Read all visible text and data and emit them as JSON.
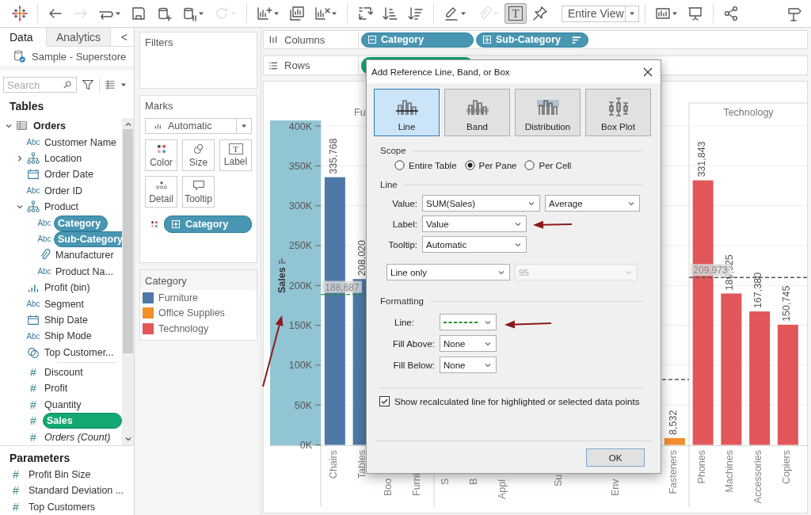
{
  "toolbar": {
    "groups": [
      [
        {
          "kind": "logo",
          "on": false,
          "disabled": false
        }
      ],
      [
        {
          "kind": "undo",
          "on": false,
          "disabled": false
        },
        {
          "kind": "redo",
          "on": false,
          "disabled": true
        },
        {
          "kind": "replay",
          "on": false,
          "disabled": false
        },
        {
          "kind": "save",
          "on": false,
          "disabled": false
        },
        {
          "kind": "new-source",
          "on": false,
          "disabled": false
        },
        {
          "kind": "pause",
          "on": false,
          "disabled": false
        },
        {
          "kind": "refresh",
          "on": false,
          "disabled": true
        }
      ],
      [
        {
          "kind": "new-sheet",
          "on": false,
          "disabled": false
        },
        {
          "kind": "duplicate",
          "on": false,
          "disabled": false
        },
        {
          "kind": "clear",
          "on": false,
          "disabled": false
        }
      ],
      [
        {
          "kind": "swap",
          "on": false,
          "disabled": false
        },
        {
          "kind": "sort-asc",
          "on": false,
          "disabled": false
        },
        {
          "kind": "sort-desc",
          "on": false,
          "disabled": false
        }
      ],
      [
        {
          "kind": "highlight",
          "on": false,
          "disabled": false
        },
        {
          "kind": "annotate",
          "on": false,
          "disabled": true
        },
        {
          "kind": "labels",
          "glyph": "T",
          "on": true,
          "disabled": false
        },
        {
          "kind": "pin",
          "on": false,
          "disabled": false
        },
        {
          "kind": "fit",
          "label": "Entire View"
        }
      ],
      [
        {
          "kind": "show-me",
          "on": false,
          "disabled": false
        },
        {
          "kind": "present",
          "on": false,
          "disabled": false
        }
      ],
      [
        {
          "kind": "share",
          "on": false,
          "disabled": false
        }
      ],
      [
        {
          "kind": "signpost",
          "on": false,
          "disabled": false
        }
      ]
    ]
  },
  "data_pane": {
    "tabs": [
      {
        "label": "Data",
        "selected": true
      },
      {
        "label": "Analytics",
        "selected": false
      }
    ],
    "collapse": "<",
    "source": "Sample - Superstore",
    "search": {
      "placeholder": "Search"
    },
    "tables_heading": "Tables",
    "tables": [
      {
        "name": "Orders",
        "kind": "table",
        "expanded": true,
        "selected": false,
        "children": [
          {
            "name": "Customer Name",
            "kind": "string",
            "icon_text": "Abc",
            "selected": false
          },
          {
            "name": "Location",
            "kind": "hierarchy",
            "expanded": false,
            "selected": false
          },
          {
            "name": "Order Date",
            "kind": "date",
            "selected": false
          },
          {
            "name": "Order ID",
            "kind": "string",
            "icon_text": "Abc",
            "selected": false
          },
          {
            "name": "Product",
            "kind": "hierarchy",
            "expanded": true,
            "selected": false,
            "children": [
              {
                "name": "Category",
                "kind": "string",
                "icon_text": "Abc",
                "selected": true
              },
              {
                "name": "Sub-Category",
                "kind": "string",
                "icon_text": "Abc",
                "selected": true
              },
              {
                "name": "Manufacturer",
                "kind": "group",
                "selected": false
              },
              {
                "name": "Product Na...",
                "kind": "string",
                "icon_text": "Abc",
                "selected": false
              }
            ]
          },
          {
            "name": "Profit (bin)",
            "kind": "bin",
            "selected": false
          },
          {
            "name": "Segment",
            "kind": "string",
            "icon_text": "Abc",
            "selected": false
          },
          {
            "name": "Ship Date",
            "kind": "date",
            "selected": false
          },
          {
            "name": "Ship Mode",
            "kind": "string",
            "icon_text": "Abc",
            "selected": false
          },
          {
            "name": "Top Customer...",
            "kind": "set",
            "selected": false
          },
          {
            "name": "Discount",
            "kind": "measure",
            "icon_text": "#",
            "selected": false
          },
          {
            "name": "Profit",
            "kind": "measure",
            "icon_text": "#",
            "selected": false
          },
          {
            "name": "Quantity",
            "kind": "measure",
            "icon_text": "#",
            "selected": false
          },
          {
            "name": "Sales",
            "kind": "measure",
            "icon_text": "#",
            "selected": true
          },
          {
            "name": "Orders (Count)",
            "kind": "count",
            "icon_text": "#",
            "selected": false
          }
        ]
      }
    ],
    "parameters_heading": "Parameters",
    "parameters": [
      {
        "name": "Profit Bin Size",
        "icon_text": "#"
      },
      {
        "name": "Standard Deviation ...",
        "icon_text": "#"
      },
      {
        "name": "Top Customers",
        "icon_text": "#"
      }
    ]
  },
  "filters": {
    "title": "Filters"
  },
  "marks": {
    "title": "Marks",
    "mark_type": "Automatic",
    "buttons": [
      {
        "label": "Color",
        "kind": "color"
      },
      {
        "label": "Size",
        "kind": "size"
      },
      {
        "label": "Label",
        "kind": "label",
        "glyph": "T"
      },
      {
        "label": "Detail",
        "kind": "detail"
      },
      {
        "label": "Tooltip",
        "kind": "tooltip"
      }
    ],
    "pills": [
      {
        "label": "Category",
        "kind": "color"
      }
    ]
  },
  "legend": {
    "title": "Category",
    "items": [
      {
        "label": "Furniture",
        "color": "#4e79a7"
      },
      {
        "label": "Office Supplies",
        "color": "#f28e2b"
      },
      {
        "label": "Technology",
        "color": "#e15759"
      }
    ]
  },
  "columns_shelf": {
    "label": "Columns",
    "pills": [
      {
        "label": "Category",
        "expanded": true,
        "sorted": false
      },
      {
        "label": "Sub-Category",
        "expanded": false,
        "sorted": true
      }
    ]
  },
  "rows_shelf": {
    "label": "Rows",
    "pills": [
      {
        "kind": "measure"
      }
    ]
  },
  "viz": {
    "axis_selected": true,
    "pane_headers": [
      "Fu",
      "Technology"
    ],
    "cut_axis_labels": [
      "Boo",
      "Furni",
      "S",
      "B",
      "Appl",
      "Su",
      "Env"
    ],
    "chart_data": {
      "type": "bar",
      "ylabel": "Sales",
      "grid": true,
      "ylim": [
        0,
        407000
      ],
      "categories": [
        "Chairs",
        "Tables",
        null,
        null,
        null,
        null,
        null,
        null,
        null,
        null,
        null,
        null,
        "Fasteners",
        "Phones",
        "Machines",
        "Accessories",
        "Copiers"
      ],
      "series": [
        {
          "color": "#4e79a7",
          "values": [
            335768,
            208020,
            null,
            null,
            null,
            null,
            null,
            null,
            null,
            null,
            null,
            null,
            null,
            null,
            null,
            null,
            null
          ]
        },
        {
          "color": "#f28e2b",
          "values": [
            null,
            null,
            null,
            null,
            null,
            null,
            null,
            null,
            null,
            null,
            null,
            null,
            8532,
            null,
            null,
            null,
            null
          ]
        },
        {
          "color": "#e15759",
          "values": [
            null,
            null,
            null,
            null,
            null,
            null,
            null,
            null,
            null,
            null,
            null,
            null,
            null,
            331843,
            189925,
            167380,
            150745
          ]
        }
      ],
      "value_labels": [
        "335,768",
        "208,020",
        null,
        null,
        null,
        null,
        null,
        null,
        null,
        null,
        null,
        null,
        "8,532",
        "331,843",
        "189,925",
        "167,380",
        "150,745"
      ],
      "yticks": [
        {
          "value": 0,
          "label": "0K"
        },
        {
          "value": 50000,
          "label": "50K"
        },
        {
          "value": 100000,
          "label": "100K"
        },
        {
          "value": 150000,
          "label": "150K"
        },
        {
          "value": 200000,
          "label": "200K"
        },
        {
          "value": 250000,
          "label": "250K"
        },
        {
          "value": 300000,
          "label": "300K"
        },
        {
          "value": 350000,
          "label": "350K"
        },
        {
          "value": 400000,
          "label": "400K"
        }
      ],
      "ref_lines": [
        {
          "axis": "y",
          "value": 188687,
          "label": "188,687",
          "color": "#2e8b2e"
        },
        {
          "axis": "y",
          "value": 209973,
          "label": "209,973",
          "color": "#555555"
        }
      ]
    }
  },
  "dialog": {
    "title": "Add Reference Line, Band, or Box",
    "types": [
      {
        "label": "Line",
        "kind": "line",
        "selected": true
      },
      {
        "label": "Band",
        "kind": "band",
        "selected": false
      },
      {
        "label": "Distribution",
        "kind": "distribution",
        "selected": false
      },
      {
        "label": "Box Plot",
        "kind": "boxplot",
        "selected": false
      }
    ],
    "scope": {
      "title": "Scope",
      "options": [
        {
          "label": "Entire Table",
          "selected": false
        },
        {
          "label": "Per Pane",
          "selected": true
        },
        {
          "label": "Per Cell",
          "selected": false
        }
      ]
    },
    "line": {
      "title": "Line",
      "value": {
        "label": "Value:",
        "field": "SUM(Sales)",
        "aggregation": "Average"
      },
      "label": {
        "label": "Label:",
        "value": "Value"
      },
      "tooltip": {
        "label": "Tooltip:",
        "value": "Automatic"
      },
      "interval": {
        "value": "Line only"
      },
      "confidence": {
        "value": "95",
        "disabled": true
      }
    },
    "formatting": {
      "title": "Formatting",
      "line": {
        "label": "Line:",
        "color": "#2e8b2e"
      },
      "fill_above": {
        "label": "Fill Above:",
        "value": "None"
      },
      "fill_below": {
        "label": "Fill Below:",
        "value": "None"
      }
    },
    "recalculate": {
      "label": "Show recalculated line for highlighted or selected data points",
      "checked": true
    },
    "ok": "OK"
  }
}
